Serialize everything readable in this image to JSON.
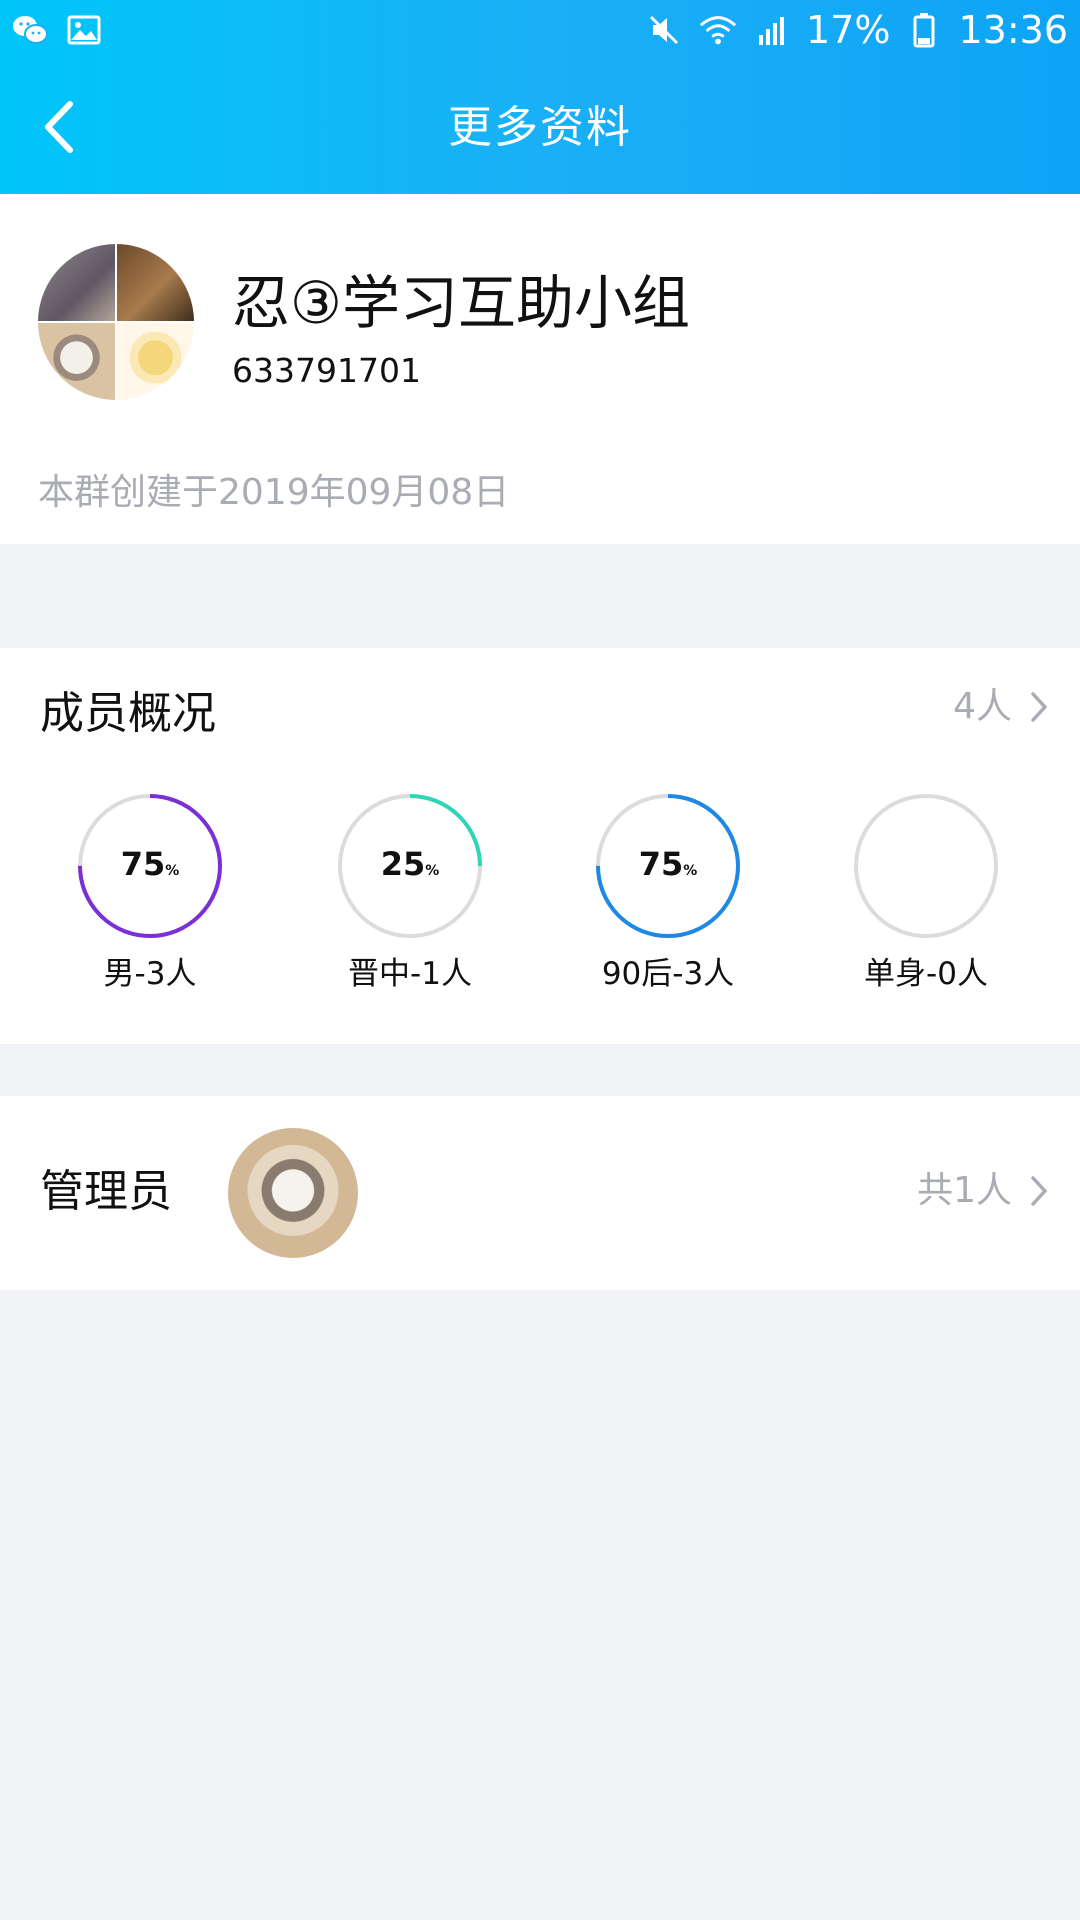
{
  "status_bar": {
    "battery": "17%",
    "time": "13:36",
    "left_icons": [
      "wechat-icon",
      "image-icon"
    ],
    "right_icons": [
      "mute-icon",
      "wifi-icon",
      "signal-4g-icon",
      "battery-icon"
    ]
  },
  "nav": {
    "title": "更多资料",
    "back_icon": "chevron-left-icon"
  },
  "group": {
    "name": "忍③学习互助小组",
    "id": "633791701",
    "created": "本群创建于2019年09月08日"
  },
  "members": {
    "title": "成员概况",
    "count": "4人",
    "stats": [
      {
        "value": "75",
        "unit": "%",
        "label": "男-3人",
        "fraction": 0.75,
        "color": "#7b2fd6"
      },
      {
        "value": "25",
        "unit": "%",
        "label": "晋中-1人",
        "fraction": 0.25,
        "color": "#2fd5b7"
      },
      {
        "value": "75",
        "unit": "%",
        "label": "90后-3人",
        "fraction": 0.75,
        "color": "#1e88e5"
      },
      {
        "value": "",
        "unit": "",
        "label": "单身-0人",
        "fraction": 0,
        "color": "#dcdcdc"
      }
    ]
  },
  "admin": {
    "title": "管理员",
    "count": "共1人"
  },
  "colors": {
    "header_start": "#00c6f8",
    "header_end": "#0ea4f6",
    "page_bg": "#f2f3f7",
    "muted_text": "#a9acb3",
    "ring_track": "#dcdcdc"
  }
}
